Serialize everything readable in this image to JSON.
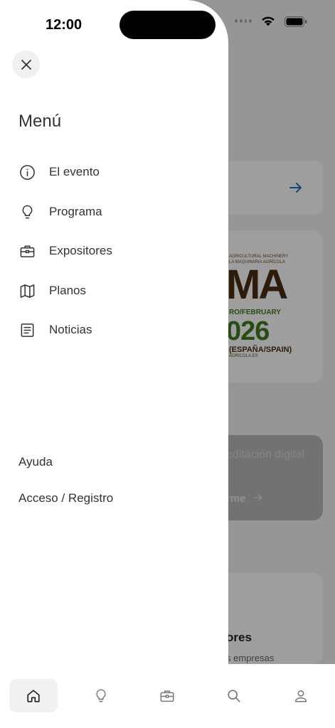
{
  "status_bar": {
    "time": "12:00"
  },
  "background": {
    "poster": {
      "line1": "AGRICULTURAL MACHINERY",
      "line2": "LA MAQUINARIA AGRÍCOLA",
      "logo": "MA",
      "date": "RO/FEBRUARY",
      "year": "026",
      "location": "(ESPAÑA/SPAIN)",
      "web": "AGRICOLA.ES"
    },
    "promo": {
      "text": "editación digital",
      "cta": "rme"
    },
    "section": {
      "title": "ores",
      "subtitle": "s empresas"
    },
    "accent_color": "#2d6fb8"
  },
  "drawer": {
    "title": "Menú",
    "items": [
      {
        "label": "El evento",
        "icon": "info-icon"
      },
      {
        "label": "Programa",
        "icon": "lightbulb-icon"
      },
      {
        "label": "Expositores",
        "icon": "briefcase-icon"
      },
      {
        "label": "Planos",
        "icon": "map-icon"
      },
      {
        "label": "Noticias",
        "icon": "newspaper-icon"
      }
    ],
    "links": [
      {
        "label": "Ayuda"
      },
      {
        "label": "Acceso / Registro"
      }
    ]
  },
  "tabbar": {
    "tabs": [
      {
        "icon": "home-icon",
        "active": true
      },
      {
        "icon": "lightbulb-icon",
        "active": false
      },
      {
        "icon": "briefcase-icon",
        "active": false
      },
      {
        "icon": "search-icon",
        "active": false
      },
      {
        "icon": "user-icon",
        "active": false
      }
    ]
  }
}
